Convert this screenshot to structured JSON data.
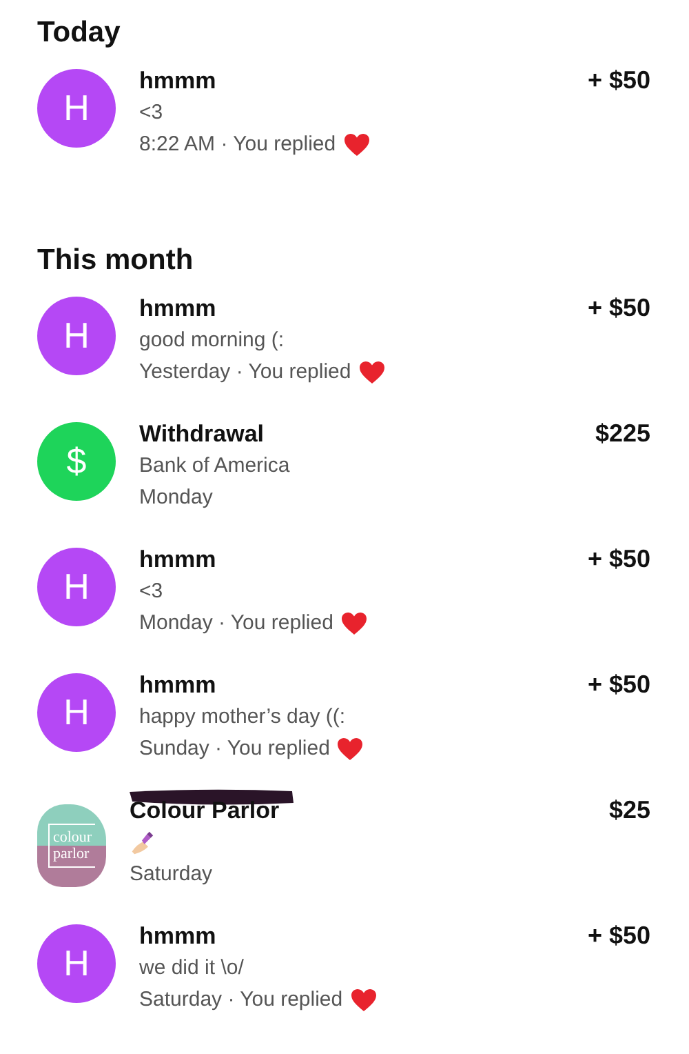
{
  "sections": [
    {
      "title": "Today",
      "rows": [
        {
          "avatar": {
            "kind": "letter",
            "text": "H",
            "color": "#b548f5"
          },
          "name": "hmmm",
          "amount": "+ $50",
          "memo": "<3",
          "when": "8:22 AM",
          "replied": "· You replied",
          "reaction": true
        }
      ]
    },
    {
      "title": "This month",
      "rows": [
        {
          "avatar": {
            "kind": "letter",
            "text": "H",
            "color": "#b548f5"
          },
          "name": "hmmm",
          "amount": "+ $50",
          "memo": "good morning (:",
          "when": "Yesterday",
          "replied": "· You replied",
          "reaction": true
        },
        {
          "avatar": {
            "kind": "cash",
            "text": "$",
            "color": "#1ed45a"
          },
          "name": "Withdrawal",
          "amount": "$225",
          "memo": "Bank of America",
          "when": "Monday",
          "reaction": false
        },
        {
          "avatar": {
            "kind": "letter",
            "text": "H",
            "color": "#b548f5"
          },
          "name": "hmmm",
          "amount": "+ $50",
          "memo": "<3",
          "when": "Monday",
          "replied": "· You replied",
          "reaction": true
        },
        {
          "avatar": {
            "kind": "letter",
            "text": "H",
            "color": "#b548f5"
          },
          "name": "hmmm",
          "amount": "+ $50",
          "memo": "happy mother’s day ((:",
          "when": "Sunday",
          "replied": "· You replied",
          "reaction": true
        },
        {
          "avatar": {
            "kind": "logo",
            "lines": [
              "colour",
              "parlor"
            ]
          },
          "name": "Colour Parlor",
          "redacted": true,
          "amount": "$25",
          "memo_icon": true,
          "when": "Saturday",
          "reaction": false
        },
        {
          "avatar": {
            "kind": "letter",
            "text": "H",
            "color": "#b548f5"
          },
          "name": "hmmm",
          "amount": "+ $50",
          "memo": "we did it \\o/",
          "when": "Saturday",
          "replied": "· You replied",
          "reaction": true
        }
      ]
    }
  ]
}
